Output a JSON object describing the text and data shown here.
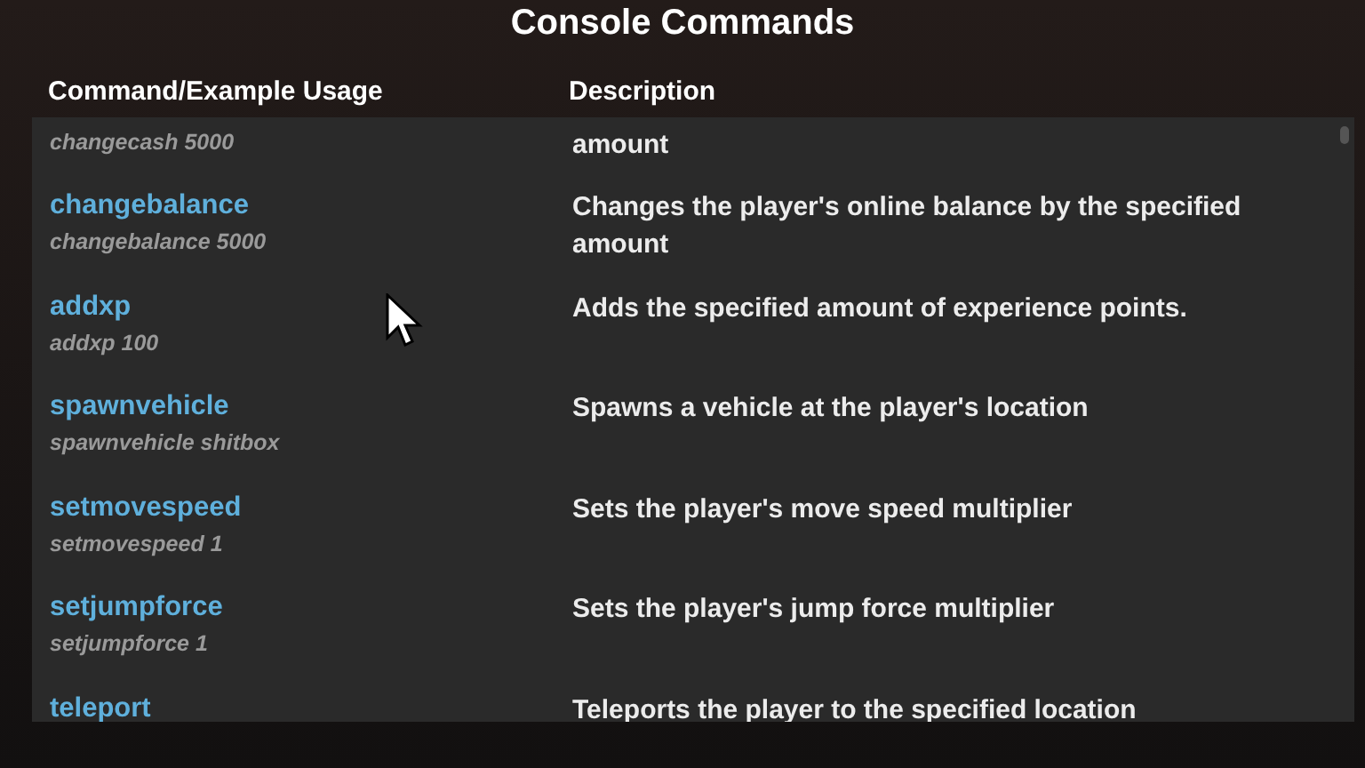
{
  "title": "Console Commands",
  "columns": [
    "Command/Example Usage",
    "Description"
  ],
  "rows": [
    {
      "usage": "changecash 5000",
      "description": "amount"
    },
    {
      "command": "changebalance",
      "usage": "changebalance 5000",
      "description": "Changes the player's online balance by the specified amount"
    },
    {
      "command": "addxp",
      "usage": "addxp 100",
      "description": "Adds the specified amount of experience points."
    },
    {
      "command": "spawnvehicle",
      "usage": "spawnvehicle shitbox",
      "description": "Spawns a vehicle at the player's location"
    },
    {
      "command": "setmovespeed",
      "usage": "setmovespeed 1",
      "description": "Sets the player's move speed multiplier"
    },
    {
      "command": "setjumpforce",
      "usage": "setjumpforce 1",
      "description": "Sets the player's jump force multiplier"
    },
    {
      "command": "teleport",
      "description": "Teleports the player to the specified location"
    }
  ]
}
